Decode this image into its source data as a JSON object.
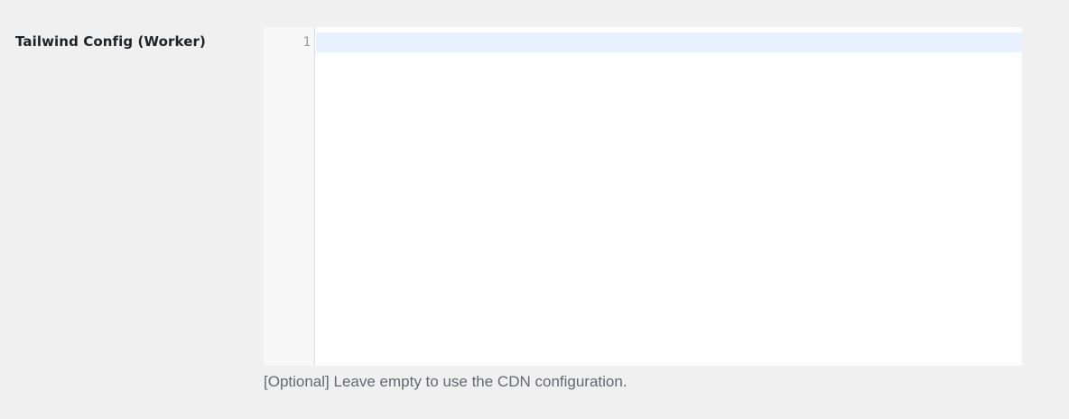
{
  "field": {
    "label": "Tailwind Config (Worker)",
    "description": "[Optional] Leave empty to use the CDN configuration."
  },
  "editor": {
    "line_numbers": [
      "1"
    ],
    "content": ""
  }
}
